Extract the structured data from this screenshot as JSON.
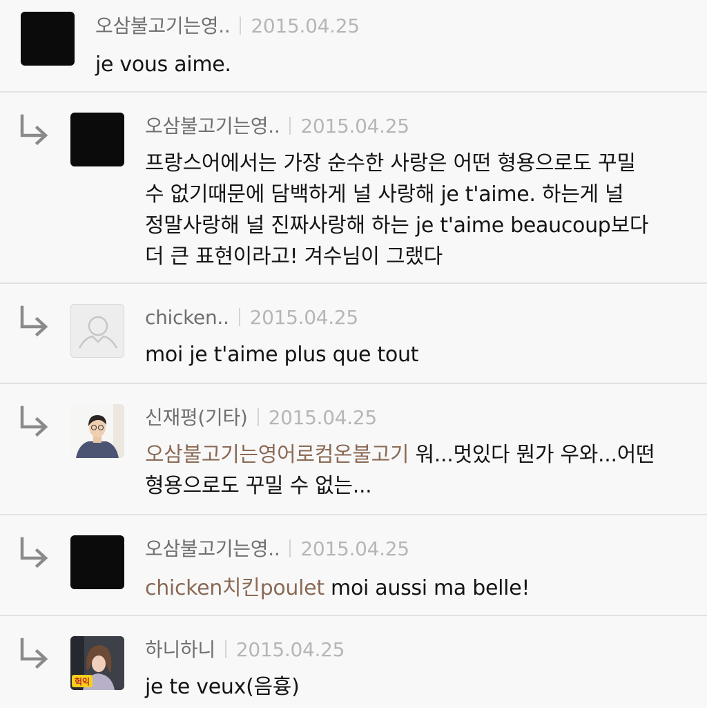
{
  "comments": [
    {
      "author": "오삼불고기는영..",
      "date": "2015.04.25",
      "text": "je vous aime."
    },
    {
      "author": "오삼불고기는영..",
      "date": "2015.04.25",
      "lines": [
        "프랑스어에서는 가장 순수한 사랑은 어떤 형용으로도 꾸밀",
        "수 없기때문에 담백하게 널 사랑해 je t'aime. 하는게 널",
        "정말사랑해 널 진짜사랑해 하는 je t'aime beaucoup보다",
        "더 큰 표현이라고! 겨수님이 그랬다"
      ]
    },
    {
      "author": "chicken..",
      "date": "2015.04.25",
      "text": "moi je t'aime plus que tout"
    },
    {
      "author": "신재평(기타)",
      "date": "2015.04.25",
      "mention": "오삼불고기는영어로컴온불고기",
      "line1_rest": " 워...멋있다 뭔가 우와...어떤",
      "line2": "형용으로도 꾸밀 수 없는..."
    },
    {
      "author": "오삼불고기는영..",
      "date": "2015.04.25",
      "mention": "chicken치킨poulet",
      "text_rest": " moi aussi ma belle!"
    },
    {
      "author": "하니하니",
      "date": "2015.04.25",
      "text": "je te veux(음흉)"
    }
  ],
  "avatar_badge_text": "헉익",
  "icons": {
    "reply": "reply-arrow-icon",
    "default_avatar": "default-user-icon"
  },
  "colors": {
    "author": "#6f6f6f",
    "date": "#b6b6b6",
    "mention": "#8a6a56",
    "divider": "#e2e2e2",
    "background": "#f8f8f8"
  }
}
